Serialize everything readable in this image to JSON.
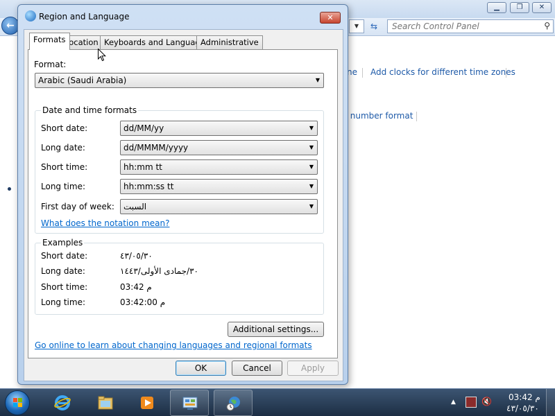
{
  "background_window": {
    "search_placeholder": "Search Control Panel",
    "links": {
      "partial_time_zone": "ne",
      "add_clocks": "Add clocks for different time zones",
      "partial_number_format": "r number format"
    }
  },
  "dialog": {
    "title": "Region and Language",
    "tabs": [
      "Formats",
      "Location",
      "Keyboards and Languages",
      "Administrative"
    ],
    "format_label": "Format:",
    "format_value": "Arabic (Saudi Arabia)",
    "date_time_group_title": "Date and time formats",
    "short_date_label": "Short date:",
    "short_date_value": "dd/MM/yy",
    "long_date_label": "Long date:",
    "long_date_value": "dd/MMMM/yyyy",
    "short_time_label": "Short time:",
    "short_time_value": "hh:mm tt",
    "long_time_label": "Long time:",
    "long_time_value": "hh:mm:ss tt",
    "first_day_label": "First day of week:",
    "first_day_value": "السبت",
    "notation_link": "What does the notation mean?",
    "examples_group_title": "Examples",
    "ex_short_date_label": "Short date:",
    "ex_short_date_value": "٤٣/٠٥/٣٠",
    "ex_long_date_label": "Long date:",
    "ex_long_date_value": "٣٠/جمادى الأولى/١٤٤٣",
    "ex_short_time_label": "Short time:",
    "ex_short_time_value": "03:42 م",
    "ex_long_time_label": "Long time:",
    "ex_long_time_value": "03:42:00 م",
    "additional_settings": "Additional settings...",
    "online_link": "Go online to learn about changing languages and regional formats",
    "ok": "OK",
    "cancel": "Cancel",
    "apply": "Apply"
  },
  "taskbar": {
    "clock_time": "03:42 م",
    "clock_date": "٤٣/٠٥/٣٠"
  },
  "colors": {
    "link": "#0066cc",
    "taskbar": "#1c2d43",
    "dialog_frame": "#b8d0ec"
  }
}
